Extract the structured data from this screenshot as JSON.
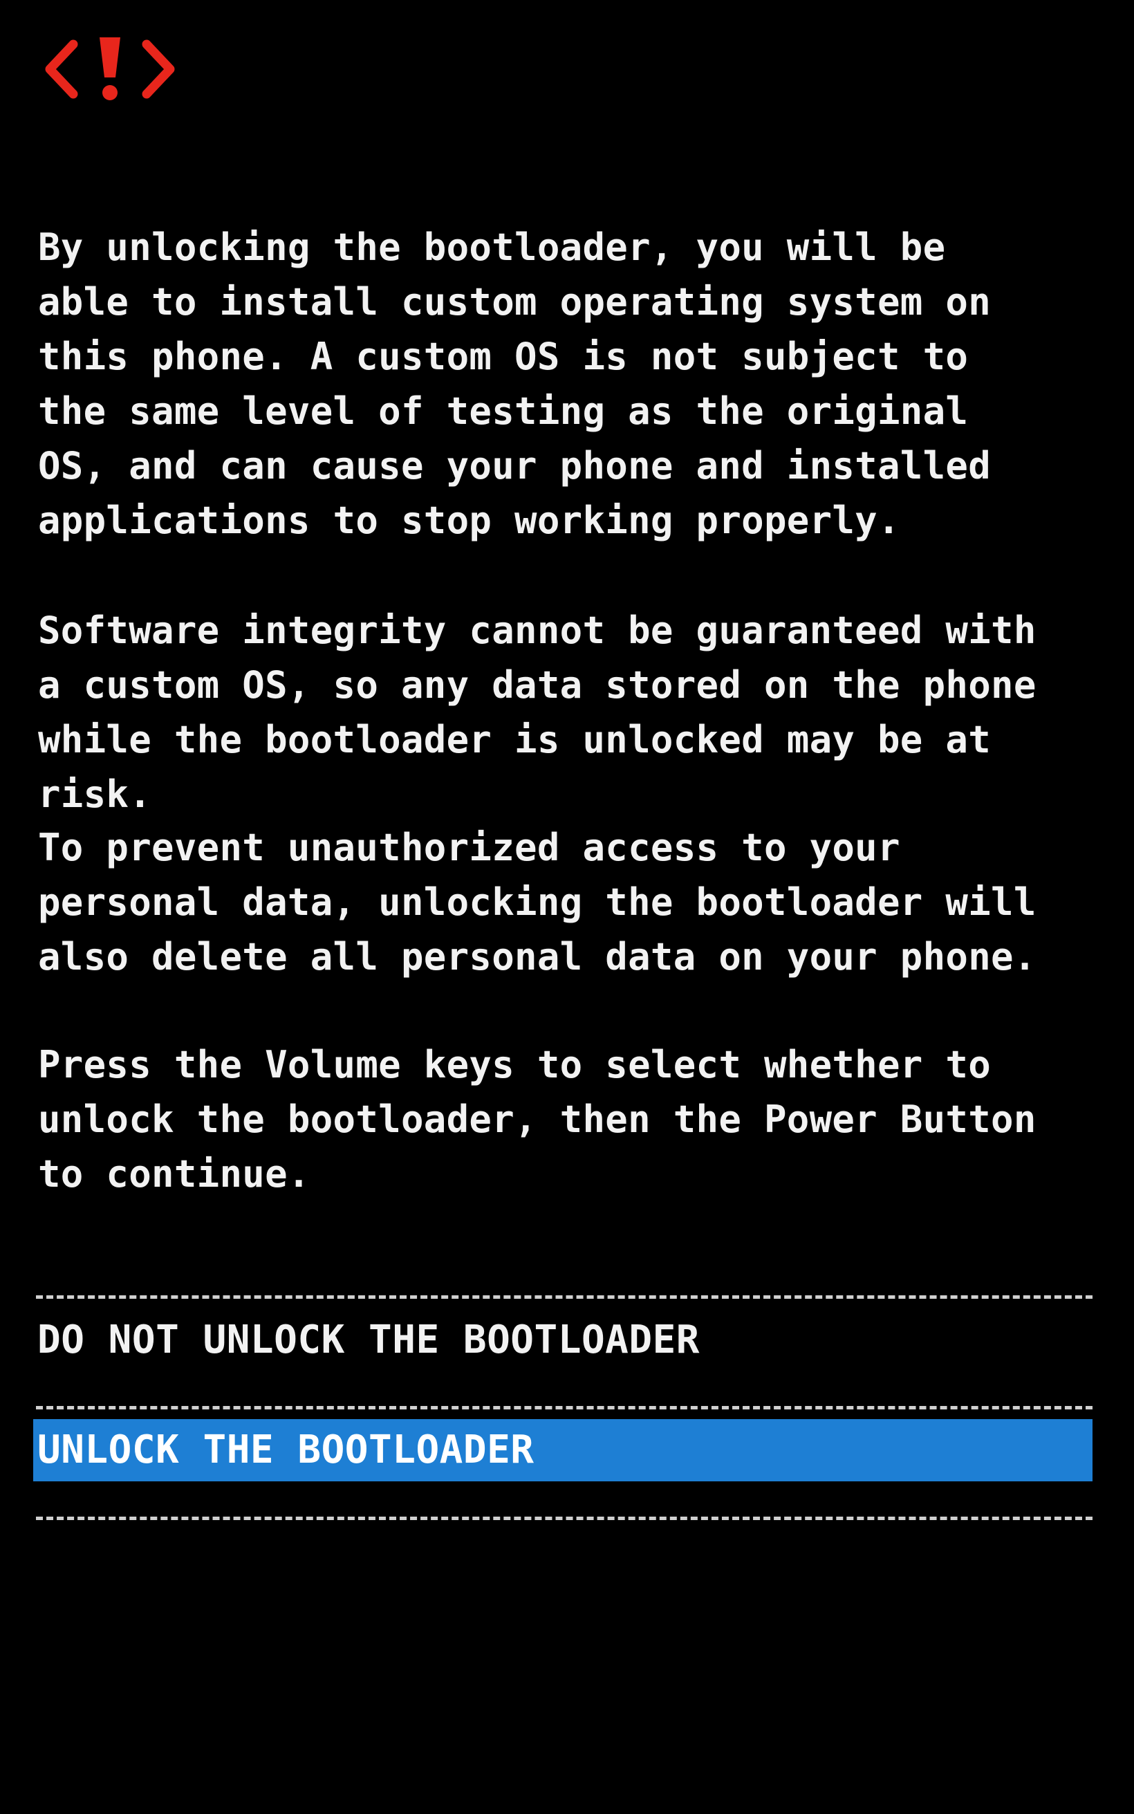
{
  "screen": {
    "icon": "bootloader-warning-icon",
    "colors": {
      "background": "#000000",
      "text": "#f2f2f2",
      "icon": "#e8261c",
      "selection": "#1e7fd4"
    }
  },
  "warning": {
    "paragraph_1": "By unlocking the bootloader, you will be\nable to install custom operating system on\nthis phone. A custom OS is not subject to\nthe same level of testing as the original\nOS, and can cause your phone and installed\napplications to stop working properly.",
    "paragraph_2": "Software integrity cannot be guaranteed with\na custom OS, so any data stored on the phone\nwhile the bootloader is unlocked may be at\nrisk.",
    "paragraph_3": "To prevent unauthorized access to your\npersonal data, unlocking the bootloader will\nalso delete all personal data on your phone.",
    "paragraph_4": "Press the Volume keys to select whether to\nunlock the bootloader, then the Power Button\nto continue."
  },
  "menu": {
    "options": [
      {
        "label": "DO NOT UNLOCK THE BOOTLOADER",
        "selected": false
      },
      {
        "label": "UNLOCK THE BOOTLOADER",
        "selected": true
      }
    ]
  }
}
